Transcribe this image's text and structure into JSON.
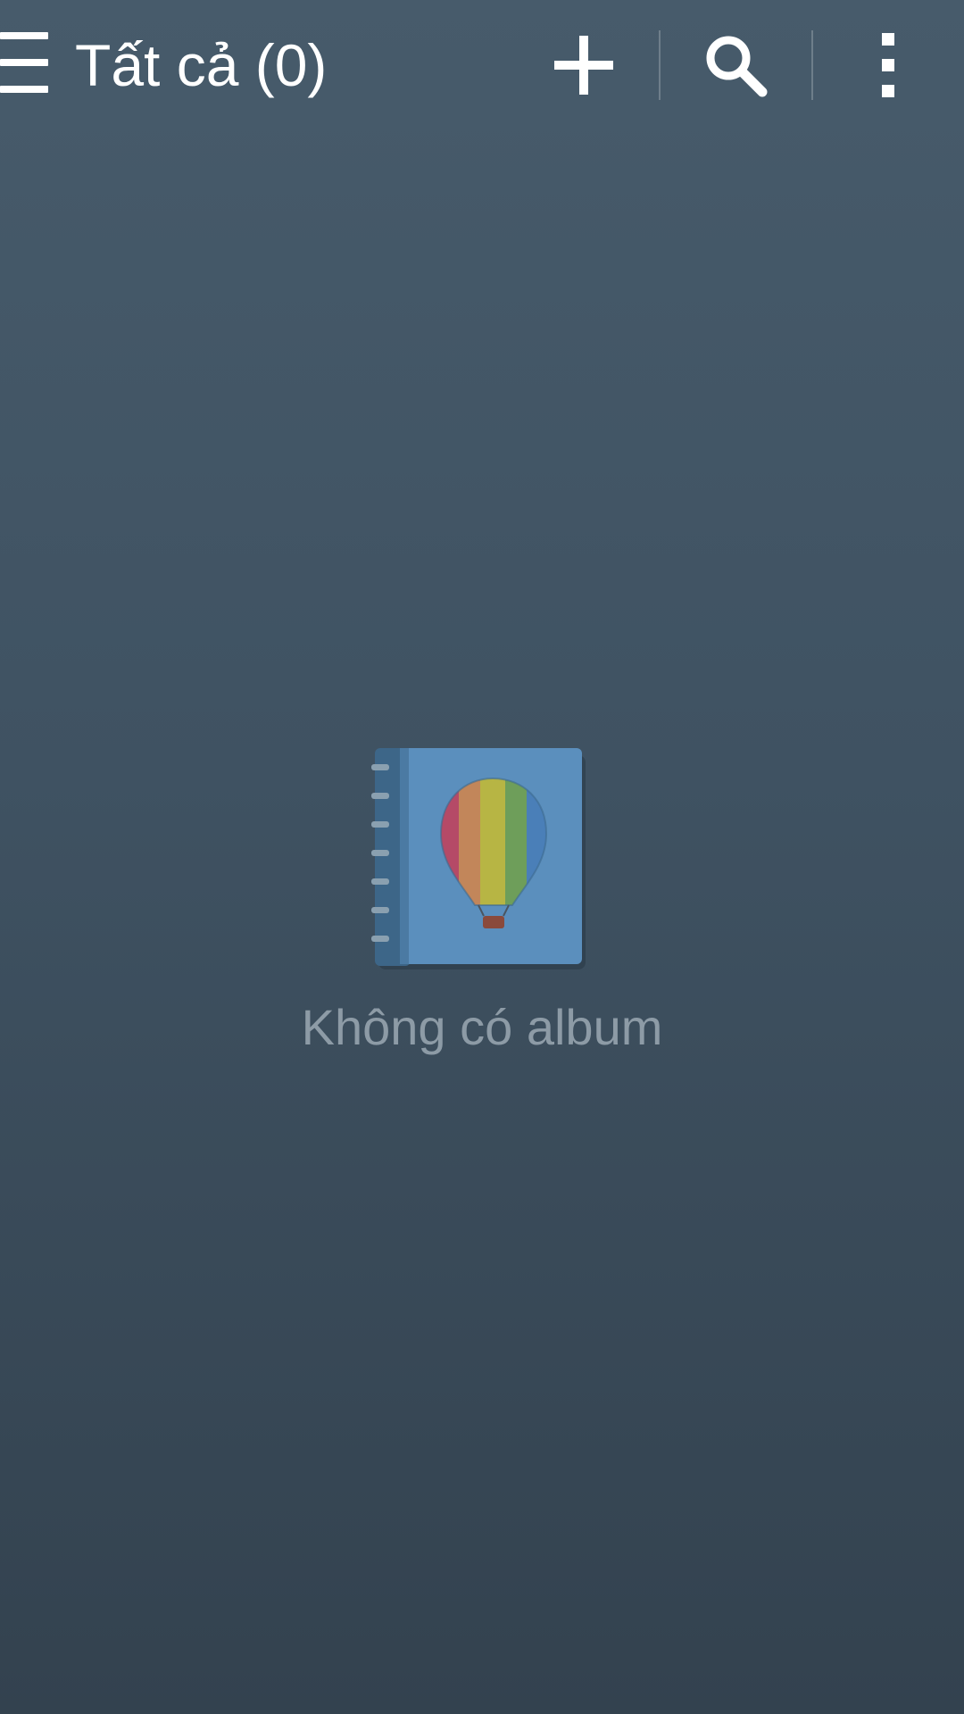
{
  "header": {
    "title": "Tất cả (0)",
    "menu_icon": "hamburger-icon",
    "actions": [
      {
        "icon": "add-icon"
      },
      {
        "icon": "search-icon"
      },
      {
        "icon": "more-vert-icon"
      }
    ]
  },
  "empty_state": {
    "icon": "album-icon",
    "message": "Không có album"
  },
  "colors": {
    "background_top": "#475b6b",
    "background_bottom": "#33424f",
    "empty_text": "#8d9ba6",
    "album_cover": "#5b8fbd"
  }
}
